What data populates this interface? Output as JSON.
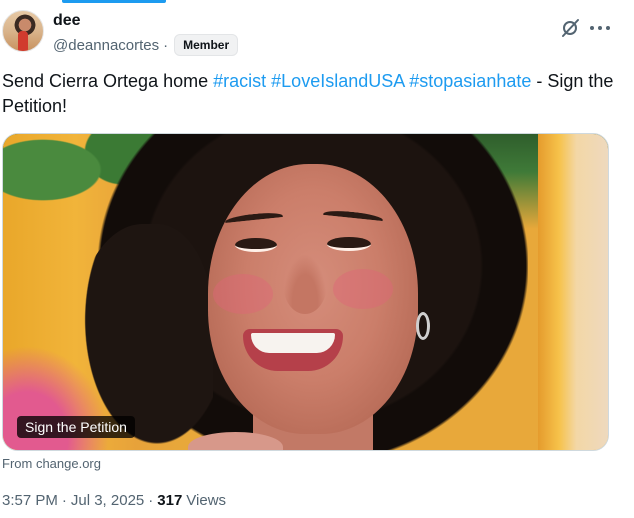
{
  "author": {
    "display_name": "dee",
    "handle": "@deannacortes",
    "separator": "·",
    "badge": "Member"
  },
  "header_icons": [
    "grok-icon",
    "more-icon"
  ],
  "tweet": {
    "text_plain": "Send Cierra Ortega home",
    "hashtags": [
      "#racist",
      "#LoveIslandUSA",
      "#stopasianhate"
    ],
    "text_tail": "- Sign the Petition!"
  },
  "card": {
    "label": "Sign the Petition",
    "source": "From change.org"
  },
  "meta": {
    "time": "3:57 PM",
    "sep": "·",
    "date": "Jul 3, 2025",
    "sep2": "·",
    "views_count": "317",
    "views_label": "Views"
  },
  "colors": {
    "link": "#1d9bf0",
    "text": "#0f1419",
    "muted": "#536471"
  }
}
